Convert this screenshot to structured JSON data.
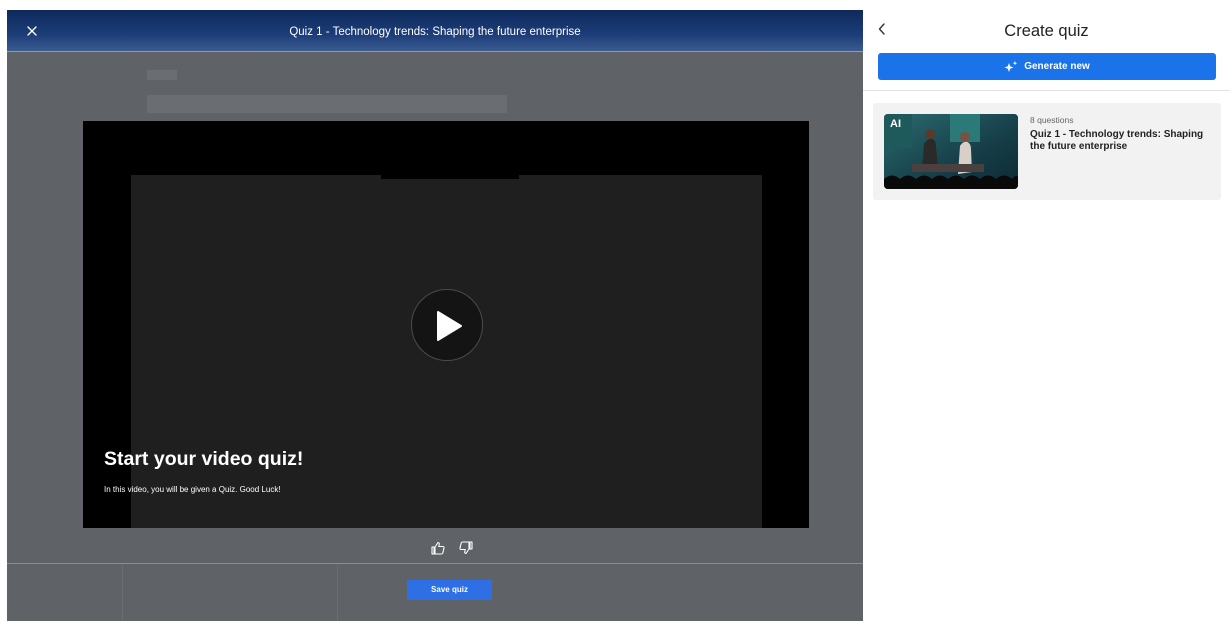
{
  "modal": {
    "title": "Quiz 1 - Technology trends: Shaping the future enterprise",
    "close_icon": "close-icon",
    "video": {
      "heading": "Start your video quiz!",
      "subtext": "In this video, you will be given a Quiz. Good Luck!",
      "play_icon": "play-icon"
    },
    "feedback": {
      "like_icon": "thumbs-up-icon",
      "dislike_icon": "thumbs-down-icon"
    },
    "save_label": "Save quiz"
  },
  "panel": {
    "title": "Create quiz",
    "back_icon": "chevron-left-icon",
    "generate_label": "Generate new",
    "generate_icon": "sparkle-icon",
    "quizzes": [
      {
        "count": "8 questions",
        "title": "Quiz 1 - Technology trends: Shaping the future enterprise",
        "thumb_text": "AI"
      }
    ]
  },
  "colors": {
    "header_bg": "#1c3d78",
    "overlay_bg": "#5f6367",
    "primary": "#1a73e8",
    "save_button": "#2f6fe6"
  }
}
